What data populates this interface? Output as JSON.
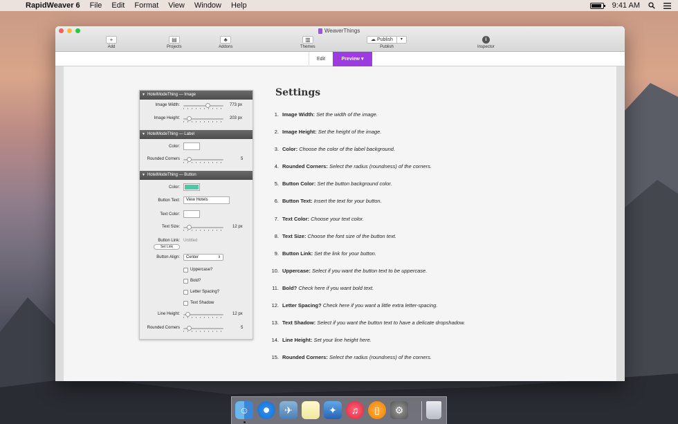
{
  "menubar": {
    "app_name": "RapidWeaver 6",
    "menus": [
      "File",
      "Edit",
      "Format",
      "View",
      "Window",
      "Help"
    ],
    "clock": "9:41 AM"
  },
  "window": {
    "title": "WeaverThings",
    "toolbar": {
      "add": "Add",
      "projects": "Projects",
      "addons": "Addons",
      "themes": "Themes",
      "publish_button": "Publish",
      "publish": "Publish",
      "inspector": "Inspector"
    },
    "modes": {
      "edit": "Edit",
      "preview": "Preview ▾"
    }
  },
  "panel": {
    "image_section": {
      "title": "HotelModeThing — Image",
      "width_label": "Image Width:",
      "width_value": "773 px",
      "width_fraction": 0.62,
      "height_label": "Image Height:",
      "height_value": "203 px",
      "height_fraction": 0.1
    },
    "label_section": {
      "title": "HotelModeThing — Label",
      "color_label": "Color:",
      "color_value": "#ffffff",
      "corners_label": "Rounded Corners",
      "corners_value": "5",
      "corners_fraction": 0.1
    },
    "button_section": {
      "title": "HotelModeThing — Button",
      "color_label": "Color:",
      "color_value": "#4ec9a6",
      "text_label": "Button Text:",
      "text_value": "View Hotels",
      "text_color_label": "Text Color:",
      "text_color_value": "#ffffff",
      "size_label": "Text Size:",
      "size_value": "12 px",
      "size_fraction": 0.1,
      "link_label": "Button Link:",
      "link_value": "Untitled",
      "set_link": "Set Link",
      "align_label": "Button Align:",
      "align_value": "Center",
      "uppercase": "Uppercase?",
      "bold": "Bold?",
      "letter_spacing": "Letter Spacing?",
      "text_shadow": "Text Shadow",
      "line_height_label": "Line Height:",
      "line_height_value": "12 px",
      "line_height_fraction": 0.05,
      "rounded_label": "Rounded Corners",
      "rounded_value": "5",
      "rounded_fraction": 0.1
    }
  },
  "doc": {
    "title": "Settings",
    "items": [
      {
        "num": "1.",
        "key": "Image Width:",
        "desc": "Set the width of the image."
      },
      {
        "num": "2.",
        "key": "Image Height:",
        "desc": "Set the height of the image."
      },
      {
        "num": "3.",
        "key": "Color:",
        "desc": "Choose the color of the label background."
      },
      {
        "num": "4.",
        "key": "Rounded Corners:",
        "desc": "Select the radius (roundness) of the corners."
      },
      {
        "num": "5.",
        "key": "Button Color:",
        "desc": "Set the button background color."
      },
      {
        "num": "6.",
        "key": "Button Text:",
        "desc": "Insert the text for your button."
      },
      {
        "num": "7.",
        "key": "Text Color:",
        "desc": "Choose your text color."
      },
      {
        "num": "8.",
        "key": "Text Size:",
        "desc": "Choose the font size of the button text."
      },
      {
        "num": "9.",
        "key": "Button Link:",
        "desc": "Set the link for your button."
      },
      {
        "num": "10.",
        "key": "Uppercase:",
        "desc": "Select if you want the button text to be uppercase."
      },
      {
        "num": "11.",
        "key": "Bold?",
        "desc": "Check here if you want bold text."
      },
      {
        "num": "12.",
        "key": "Letter Spacing?",
        "desc": "Check here if you want a little extra letter-spacing."
      },
      {
        "num": "13.",
        "key": "Text Shadow:",
        "desc": "Select if you want the button text to have a delicate dropshadow."
      },
      {
        "num": "14.",
        "key": "Line Height:",
        "desc": "Set your line height here."
      },
      {
        "num": "15.",
        "key": "Rounded Corners:",
        "desc": "Select the radius (roundness) of the corners."
      }
    ]
  },
  "dock": {
    "icons": [
      "finder-icon",
      "safari-icon",
      "preview-icon",
      "notes-icon",
      "rapidweaver-icon",
      "itunes-icon",
      "ibooks-icon",
      "system-preferences-icon",
      "trash-icon"
    ]
  }
}
